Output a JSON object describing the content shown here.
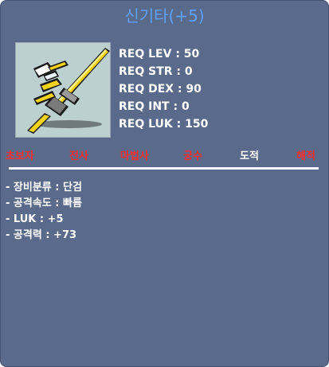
{
  "item": {
    "name": "신기타(+5)"
  },
  "requirements": [
    "REQ LEV : 50",
    "REQ STR : 0",
    "REQ DEX : 90",
    "REQ INT : 0",
    "REQ LUK : 150"
  ],
  "jobs": [
    {
      "label": "초보자",
      "equippable": false
    },
    {
      "label": "전사",
      "equippable": false
    },
    {
      "label": "마법사",
      "equippable": false
    },
    {
      "label": "궁수",
      "equippable": false
    },
    {
      "label": "도적",
      "equippable": true
    },
    {
      "label": "해적",
      "equippable": false
    }
  ],
  "stats": [
    "- 장비분류 : 단검",
    "- 공격속도 : 빠름",
    "- LUK : +5",
    "- 공격력 : +73"
  ],
  "colors": {
    "title": "#5ea0ff",
    "background": "#5a6a8a",
    "job_unavailable": "#ff2a2a",
    "job_available": "#ffffff"
  },
  "icon": "golden-guitar-dagger-icon"
}
